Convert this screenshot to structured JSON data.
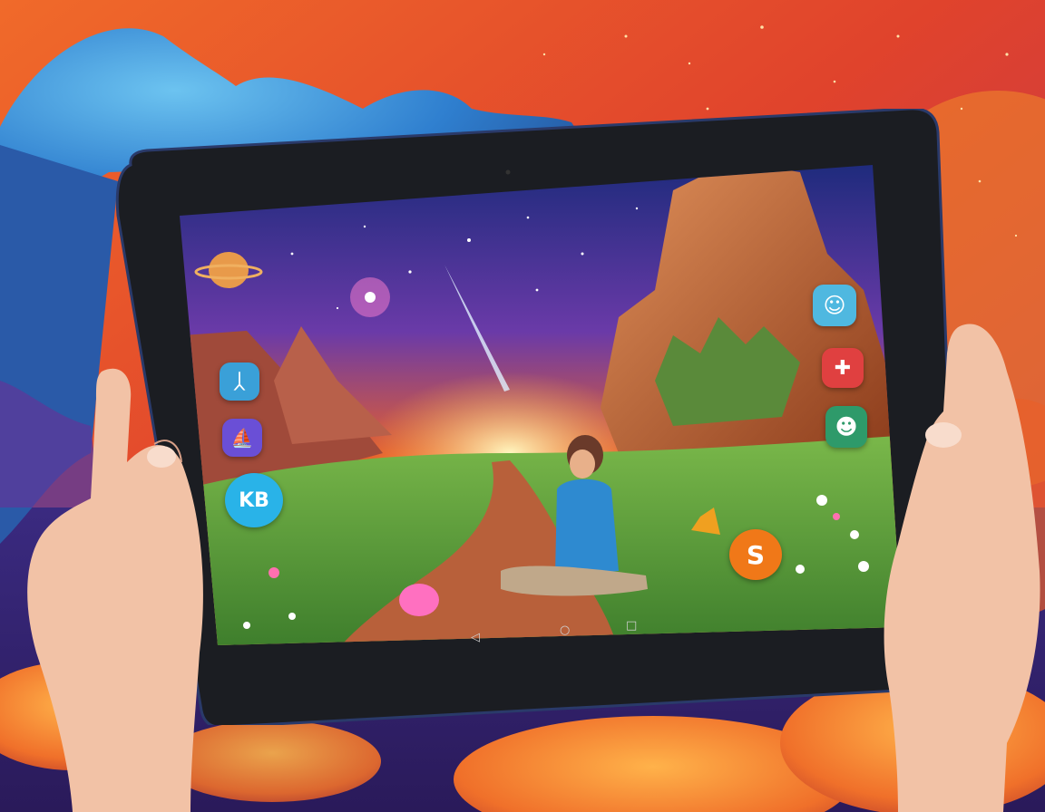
{
  "scene": {
    "description_colors": {
      "sky_top": "#e8412a",
      "sky_mid": "#f07a2a",
      "cloud_blue": "#3a8fd6",
      "ground_purple": "#4a2a6e"
    }
  },
  "tablet": {
    "frame_color": "#1b1d22",
    "screen": {
      "app_icons_left": [
        {
          "name": "app-icon-stick-figure",
          "glyph": "ᛸ",
          "color": "#3aa0d8"
        },
        {
          "name": "app-icon-sailboat",
          "glyph": "⛵",
          "color": "#6a4fd6"
        },
        {
          "name": "app-icon-kb",
          "glyph": "KB",
          "color": "#29b3e8"
        }
      ],
      "app_icons_right": [
        {
          "name": "app-icon-face",
          "glyph": "☺",
          "color": "#4fb8e0"
        },
        {
          "name": "app-icon-red",
          "glyph": "✚",
          "color": "#e04040"
        },
        {
          "name": "app-icon-character",
          "glyph": "☻",
          "color": "#2e9a6a"
        },
        {
          "name": "app-icon-orange-s",
          "glyph": "S",
          "color": "#f07818"
        }
      ],
      "nav": {
        "back": "◁",
        "home": "○",
        "recents": "□"
      }
    }
  }
}
